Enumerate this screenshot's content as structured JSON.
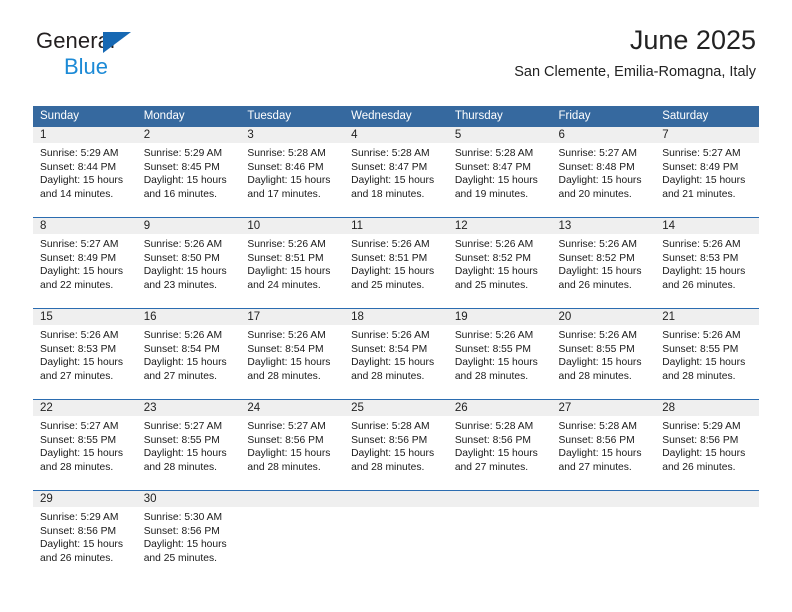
{
  "brand": {
    "line1": "General",
    "line2": "Blue",
    "triangle_color": "#1668b3",
    "blue_text_color": "#1c8ad6"
  },
  "header": {
    "title": "June 2025",
    "subtitle": "San Clemente, Emilia-Romagna, Italy"
  },
  "theme": {
    "header_band": "#36699f",
    "date_band": "#efefef",
    "row_separator": "#2b6cb0"
  },
  "calendar": {
    "weekday_headers": [
      "Sunday",
      "Monday",
      "Tuesday",
      "Wednesday",
      "Thursday",
      "Friday",
      "Saturday"
    ],
    "weeks": [
      [
        {
          "date": "1",
          "sunrise": "Sunrise: 5:29 AM",
          "sunset": "Sunset: 8:44 PM",
          "daylight": "Daylight: 15 hours and 14 minutes."
        },
        {
          "date": "2",
          "sunrise": "Sunrise: 5:29 AM",
          "sunset": "Sunset: 8:45 PM",
          "daylight": "Daylight: 15 hours and 16 minutes."
        },
        {
          "date": "3",
          "sunrise": "Sunrise: 5:28 AM",
          "sunset": "Sunset: 8:46 PM",
          "daylight": "Daylight: 15 hours and 17 minutes."
        },
        {
          "date": "4",
          "sunrise": "Sunrise: 5:28 AM",
          "sunset": "Sunset: 8:47 PM",
          "daylight": "Daylight: 15 hours and 18 minutes."
        },
        {
          "date": "5",
          "sunrise": "Sunrise: 5:28 AM",
          "sunset": "Sunset: 8:47 PM",
          "daylight": "Daylight: 15 hours and 19 minutes."
        },
        {
          "date": "6",
          "sunrise": "Sunrise: 5:27 AM",
          "sunset": "Sunset: 8:48 PM",
          "daylight": "Daylight: 15 hours and 20 minutes."
        },
        {
          "date": "7",
          "sunrise": "Sunrise: 5:27 AM",
          "sunset": "Sunset: 8:49 PM",
          "daylight": "Daylight: 15 hours and 21 minutes."
        }
      ],
      [
        {
          "date": "8",
          "sunrise": "Sunrise: 5:27 AM",
          "sunset": "Sunset: 8:49 PM",
          "daylight": "Daylight: 15 hours and 22 minutes."
        },
        {
          "date": "9",
          "sunrise": "Sunrise: 5:26 AM",
          "sunset": "Sunset: 8:50 PM",
          "daylight": "Daylight: 15 hours and 23 minutes."
        },
        {
          "date": "10",
          "sunrise": "Sunrise: 5:26 AM",
          "sunset": "Sunset: 8:51 PM",
          "daylight": "Daylight: 15 hours and 24 minutes."
        },
        {
          "date": "11",
          "sunrise": "Sunrise: 5:26 AM",
          "sunset": "Sunset: 8:51 PM",
          "daylight": "Daylight: 15 hours and 25 minutes."
        },
        {
          "date": "12",
          "sunrise": "Sunrise: 5:26 AM",
          "sunset": "Sunset: 8:52 PM",
          "daylight": "Daylight: 15 hours and 25 minutes."
        },
        {
          "date": "13",
          "sunrise": "Sunrise: 5:26 AM",
          "sunset": "Sunset: 8:52 PM",
          "daylight": "Daylight: 15 hours and 26 minutes."
        },
        {
          "date": "14",
          "sunrise": "Sunrise: 5:26 AM",
          "sunset": "Sunset: 8:53 PM",
          "daylight": "Daylight: 15 hours and 26 minutes."
        }
      ],
      [
        {
          "date": "15",
          "sunrise": "Sunrise: 5:26 AM",
          "sunset": "Sunset: 8:53 PM",
          "daylight": "Daylight: 15 hours and 27 minutes."
        },
        {
          "date": "16",
          "sunrise": "Sunrise: 5:26 AM",
          "sunset": "Sunset: 8:54 PM",
          "daylight": "Daylight: 15 hours and 27 minutes."
        },
        {
          "date": "17",
          "sunrise": "Sunrise: 5:26 AM",
          "sunset": "Sunset: 8:54 PM",
          "daylight": "Daylight: 15 hours and 28 minutes."
        },
        {
          "date": "18",
          "sunrise": "Sunrise: 5:26 AM",
          "sunset": "Sunset: 8:54 PM",
          "daylight": "Daylight: 15 hours and 28 minutes."
        },
        {
          "date": "19",
          "sunrise": "Sunrise: 5:26 AM",
          "sunset": "Sunset: 8:55 PM",
          "daylight": "Daylight: 15 hours and 28 minutes."
        },
        {
          "date": "20",
          "sunrise": "Sunrise: 5:26 AM",
          "sunset": "Sunset: 8:55 PM",
          "daylight": "Daylight: 15 hours and 28 minutes."
        },
        {
          "date": "21",
          "sunrise": "Sunrise: 5:26 AM",
          "sunset": "Sunset: 8:55 PM",
          "daylight": "Daylight: 15 hours and 28 minutes."
        }
      ],
      [
        {
          "date": "22",
          "sunrise": "Sunrise: 5:27 AM",
          "sunset": "Sunset: 8:55 PM",
          "daylight": "Daylight: 15 hours and 28 minutes."
        },
        {
          "date": "23",
          "sunrise": "Sunrise: 5:27 AM",
          "sunset": "Sunset: 8:55 PM",
          "daylight": "Daylight: 15 hours and 28 minutes."
        },
        {
          "date": "24",
          "sunrise": "Sunrise: 5:27 AM",
          "sunset": "Sunset: 8:56 PM",
          "daylight": "Daylight: 15 hours and 28 minutes."
        },
        {
          "date": "25",
          "sunrise": "Sunrise: 5:28 AM",
          "sunset": "Sunset: 8:56 PM",
          "daylight": "Daylight: 15 hours and 28 minutes."
        },
        {
          "date": "26",
          "sunrise": "Sunrise: 5:28 AM",
          "sunset": "Sunset: 8:56 PM",
          "daylight": "Daylight: 15 hours and 27 minutes."
        },
        {
          "date": "27",
          "sunrise": "Sunrise: 5:28 AM",
          "sunset": "Sunset: 8:56 PM",
          "daylight": "Daylight: 15 hours and 27 minutes."
        },
        {
          "date": "28",
          "sunrise": "Sunrise: 5:29 AM",
          "sunset": "Sunset: 8:56 PM",
          "daylight": "Daylight: 15 hours and 26 minutes."
        }
      ],
      [
        {
          "date": "29",
          "sunrise": "Sunrise: 5:29 AM",
          "sunset": "Sunset: 8:56 PM",
          "daylight": "Daylight: 15 hours and 26 minutes."
        },
        {
          "date": "30",
          "sunrise": "Sunrise: 5:30 AM",
          "sunset": "Sunset: 8:56 PM",
          "daylight": "Daylight: 15 hours and 25 minutes."
        },
        {
          "date": "",
          "sunrise": "",
          "sunset": "",
          "daylight": ""
        },
        {
          "date": "",
          "sunrise": "",
          "sunset": "",
          "daylight": ""
        },
        {
          "date": "",
          "sunrise": "",
          "sunset": "",
          "daylight": ""
        },
        {
          "date": "",
          "sunrise": "",
          "sunset": "",
          "daylight": ""
        },
        {
          "date": "",
          "sunrise": "",
          "sunset": "",
          "daylight": ""
        }
      ]
    ]
  }
}
